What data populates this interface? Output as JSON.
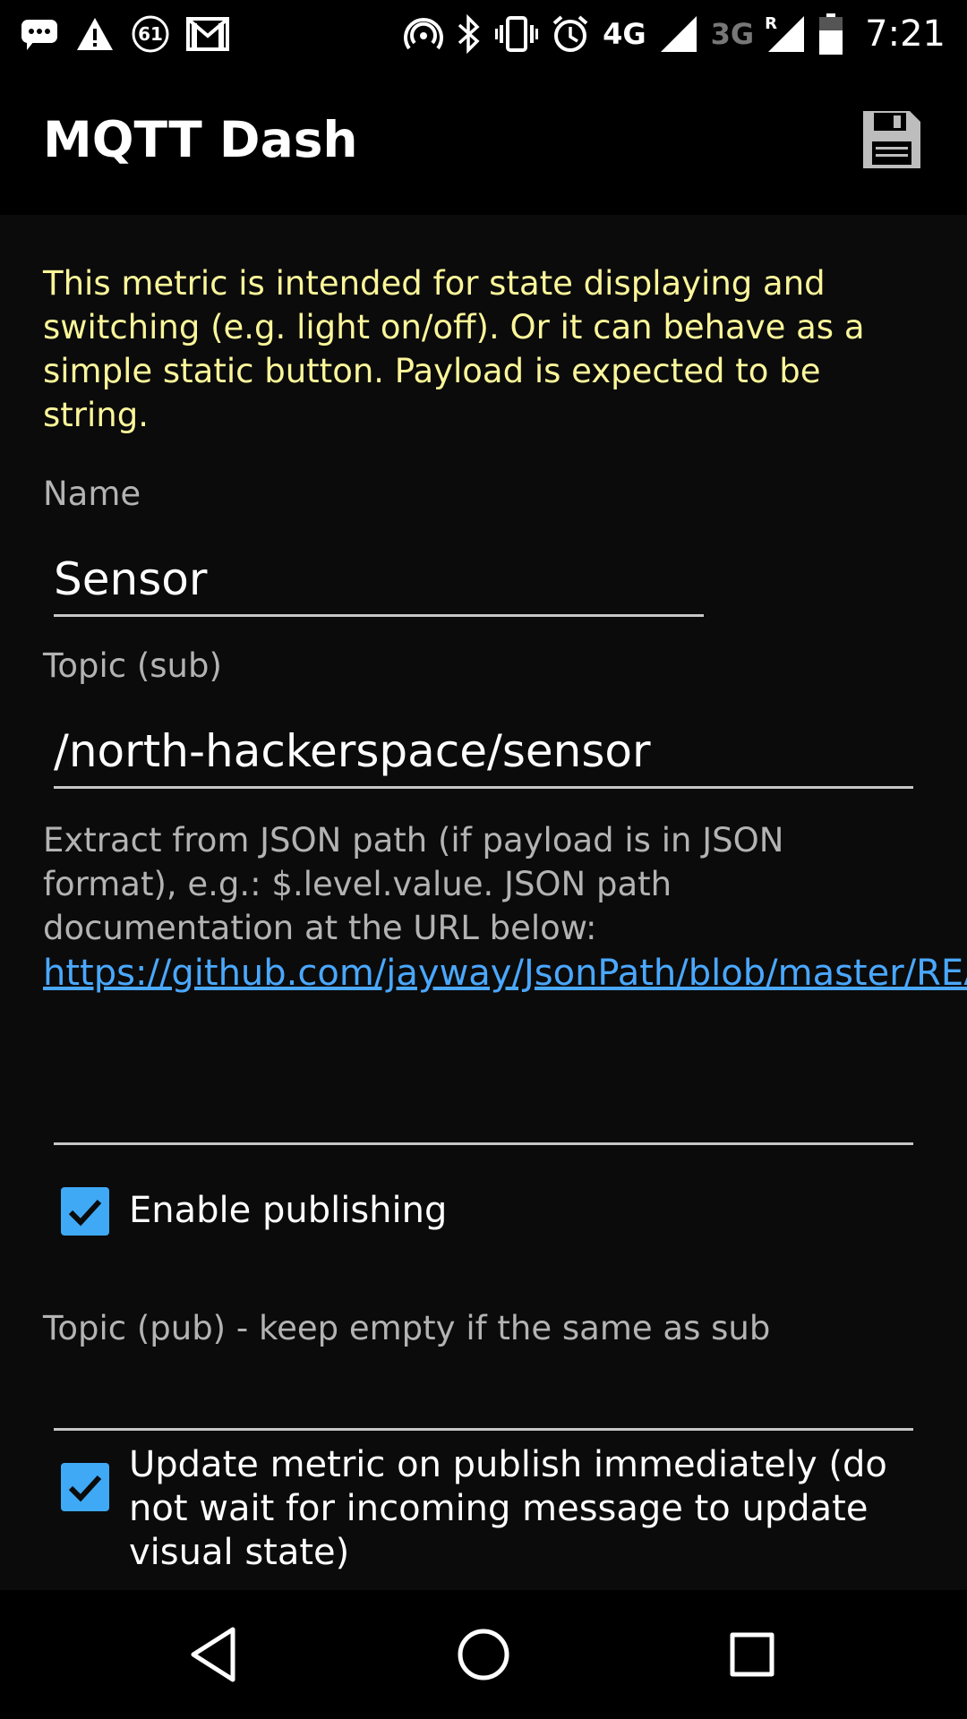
{
  "status_bar": {
    "notification_count": "61",
    "network_4g": "4G",
    "network_3g": "3G",
    "roaming": "R",
    "time": "7:21",
    "icons": [
      "chat-icon",
      "warning-icon",
      "badge-icon",
      "gmail-icon",
      "hotspot-icon",
      "bluetooth-icon",
      "vibrate-icon",
      "alarm-icon",
      "signal-icon",
      "signal-roaming-icon",
      "battery-icon"
    ]
  },
  "appbar": {
    "title": "MQTT Dash",
    "save_icon": "save-icon"
  },
  "form": {
    "description": "This metric is intended for state displaying and switching (e.g. light on/off). Or it can behave as a simple static button. Payload is expected to be string.",
    "name_label": "Name",
    "name_value": "Sensor",
    "topic_sub_label": "Topic (sub)",
    "topic_sub_value": "/north-hackerspace/sensor",
    "json_help": "Extract from JSON path (if payload is in JSON format), e.g.: $.level.value. JSON path documentation at the URL below:",
    "json_link": "https://github.com/jayway/JsonPath/blob/master/README.md",
    "json_path_value": "",
    "enable_publishing_label": "Enable publishing",
    "enable_publishing_checked": true,
    "topic_pub_label": "Topic (pub) - keep empty if the same as sub",
    "topic_pub_value": "",
    "update_on_publish_label": "Update metric on publish immediately (do not wait for incoming message to update visual state)",
    "update_on_publish_checked": true
  },
  "colors": {
    "accent": "#3fa9f5",
    "description_text": "#fbf69a",
    "link": "#4aa8ff"
  },
  "navbar": {
    "icons": [
      "back-icon",
      "home-icon",
      "recents-icon"
    ]
  }
}
